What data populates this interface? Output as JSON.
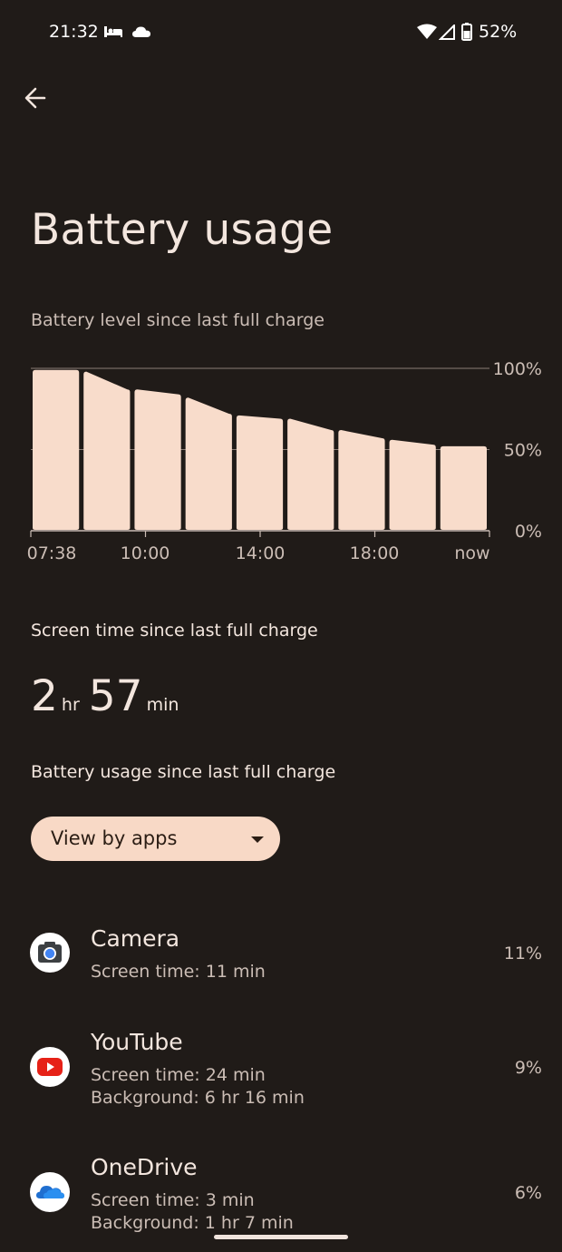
{
  "status_bar": {
    "time": "21:32",
    "battery_pct": "52%",
    "icons": [
      "sleep-icon",
      "cloud-icon",
      "wifi-icon",
      "signal-icon",
      "battery-icon"
    ]
  },
  "header": {
    "back_icon": "arrow-back-icon",
    "title": "Battery usage"
  },
  "chart_data": {
    "type": "bar",
    "title": "Battery level since last full charge",
    "categories": [
      "1",
      "2",
      "3",
      "4",
      "5",
      "6",
      "7",
      "8",
      "9"
    ],
    "values": [
      [
        99,
        99
      ],
      [
        98,
        87
      ],
      [
        87,
        84
      ],
      [
        82,
        72
      ],
      [
        71,
        69
      ],
      [
        69,
        62
      ],
      [
        62,
        57
      ],
      [
        56,
        53
      ],
      [
        52,
        52
      ]
    ],
    "y_ticks": [
      "100%",
      "50%",
      "0%"
    ],
    "x_ticks": [
      "07:38",
      "10:00",
      "14:00",
      "18:00",
      "now"
    ],
    "ylim": [
      0,
      100
    ],
    "bar_color": "#f8dccb",
    "grid": true
  },
  "screen_time": {
    "label": "Screen time since last full charge",
    "hours": "2",
    "hr_unit": "hr",
    "minutes": "57",
    "min_unit": "min"
  },
  "usage": {
    "label": "Battery usage since last full charge",
    "dropdown_value": "View by apps"
  },
  "apps": [
    {
      "name": "Camera",
      "line1": "Screen time: 11 min",
      "line2": "",
      "percent": "11%",
      "icon": "camera-icon"
    },
    {
      "name": "YouTube",
      "line1": "Screen time: 24 min",
      "line2": "Background: 6 hr 16 min",
      "percent": "9%",
      "icon": "youtube-icon"
    },
    {
      "name": "OneDrive",
      "line1": "Screen time: 3 min",
      "line2": "Background: 1 hr 7 min",
      "percent": "6%",
      "icon": "onedrive-icon"
    }
  ]
}
